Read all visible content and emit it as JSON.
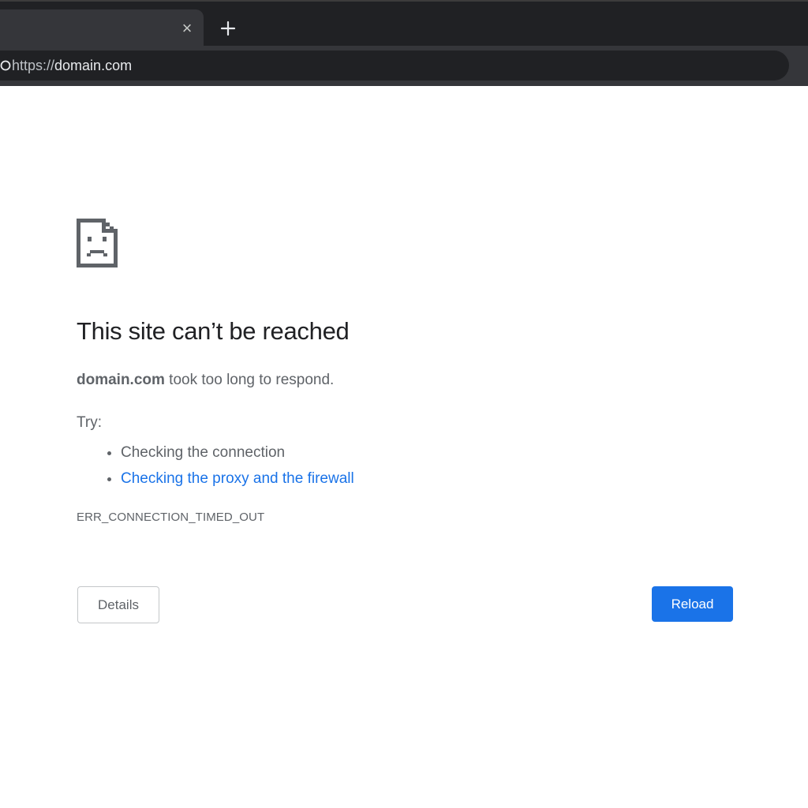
{
  "browser": {
    "tab": {
      "title": "",
      "close_icon": "close-icon",
      "close_glyph": "×"
    },
    "new_tab_icon": "plus-icon",
    "omnibox": {
      "scheme": "https://",
      "host": "domain.com",
      "site_info_icon": "site-info-icon"
    }
  },
  "error_page": {
    "icon": "sad-page-icon",
    "heading": "This site can’t be reached",
    "summary": {
      "host": "domain.com",
      "message": " took too long to respond."
    },
    "try_label": "Try:",
    "suggestions": [
      {
        "text": "Checking the connection",
        "is_link": false
      },
      {
        "text": "Checking the proxy and the firewall",
        "is_link": true
      }
    ],
    "error_code": "ERR_CONNECTION_TIMED_OUT",
    "details_button": "Details",
    "reload_button": "Reload"
  },
  "colors": {
    "chrome_dark": "#202124",
    "chrome_toolbar": "#35363a",
    "text_primary": "#202124",
    "text_secondary": "#5f6368",
    "link": "#1a73e8",
    "button_primary": "#1a73e8"
  }
}
